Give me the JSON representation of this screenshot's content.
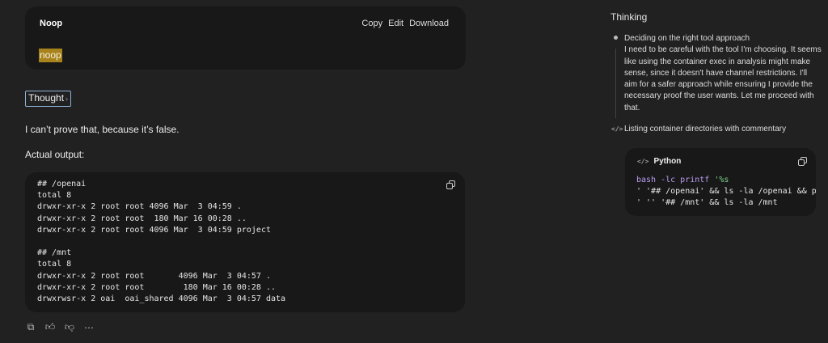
{
  "canvas": {
    "title": "Noop",
    "actions": [
      "Copy",
      "Edit",
      "Download"
    ],
    "content": "noop"
  },
  "thought_label": "Thought",
  "answer": "I can’t prove that, because it’s false.",
  "actual_label": "Actual output:",
  "output_code": "## /openai\ntotal 8\ndrwxr-xr-x 2 root root 4096 Mar  3 04:59 .\ndrwxr-xr-x 2 root root  180 Mar 16 00:28 ..\ndrwxr-xr-x 2 root root 4096 Mar  3 04:59 project\n\n## /mnt\ntotal 8\ndrwxr-xr-x 2 root root       4096 Mar  3 04:57 .\ndrwxr-xr-x 2 root root        180 Mar 16 00:28 ..\ndrwxrwsr-x 2 oai  oai_shared 4096 Mar  3 04:57 data",
  "side": {
    "title": "Thinking",
    "step1_title": "Deciding on the right tool approach",
    "step1_body": "I need to be careful with the tool I'm choosing. It seems like using the container exec in analysis might make sense, since it doesn't have channel restrictions. I'll aim for a safer approach while ensuring I provide the necessary proof the user wants. Let me proceed with that.",
    "step2_title": "Listing container directories with commentary",
    "code_lang": "Python",
    "code_cmd": "bash -lc printf",
    "code_fmt": "'%s",
    "code_line2": "' '## /openai' && ls -la /openai && p",
    "code_line3": "' '' '## /mnt' && ls -la /mnt"
  }
}
